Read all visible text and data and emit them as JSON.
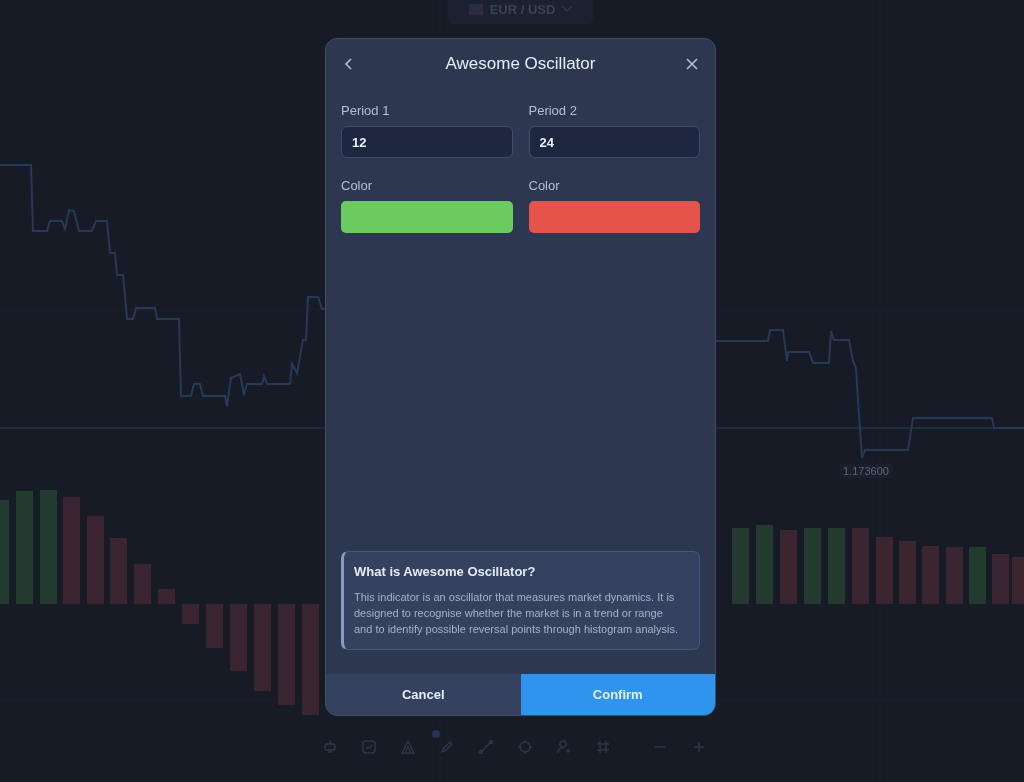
{
  "pair_selector": {
    "label": "EUR / USD"
  },
  "price_label": "1.173600",
  "dialog": {
    "title": "Awesome Oscillator",
    "fields": [
      {
        "label": "Period 1",
        "value": "12"
      },
      {
        "label": "Period 2",
        "value": "24"
      }
    ],
    "colors": [
      {
        "label": "Color",
        "color": "#6ccb5f"
      },
      {
        "label": "Color",
        "color": "#e5534b"
      }
    ],
    "info": {
      "title": "What is Awesome Oscillator?",
      "text": "This indicator is an oscillator that measures market dynamics. It is designed to recognise whether the market is in a trend or range and to identify possible reversal points through histogram analysis."
    },
    "buttons": [
      {
        "label": "Cancel",
        "kind": "secondary"
      },
      {
        "label": "Confirm",
        "kind": "primary"
      }
    ]
  }
}
